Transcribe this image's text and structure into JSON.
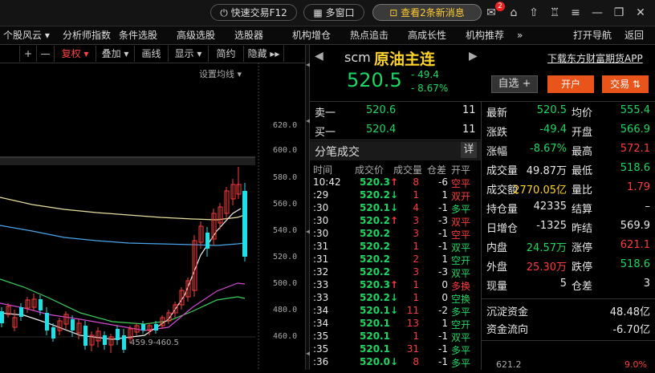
{
  "topbar": {
    "quick_trade": "快速交易F12",
    "multi_window": "多窗口",
    "news": "查看2条新消息",
    "badge": "2"
  },
  "menu": [
    "个股风云 ▾",
    "分析师指数",
    "条件选股",
    "高级选股",
    "选股器",
    "机构增仓",
    "热点追击",
    "高成长性",
    "机构推荐",
    "»",
    "打开导航",
    "返回"
  ],
  "chart_toolbar": [
    "+",
    "—",
    "复权 ▾",
    "叠加 ▾",
    "画线",
    "显示 ▾",
    "简约",
    "隐藏 ▸▸"
  ],
  "chart": {
    "avg_setting": "设置均线 ▾",
    "y_labels": [
      "620.0",
      "600.0",
      "580.0",
      "560.0",
      "540.0",
      "520.0",
      "500.0",
      "480.0",
      "460.0"
    ],
    "low_annotation": "459.9-460.5"
  },
  "quote": {
    "code": "scm",
    "name": "原油主连",
    "price": "520.5",
    "change": "- 49.4",
    "change_pct": "- 8.67%",
    "ad_link": "下载东方财富期货APP",
    "btn_self": "自选 +",
    "btn_open": "开户",
    "btn_trade": "交易 ⇅"
  },
  "orderbook": [
    {
      "label": "卖一",
      "price": "520.6",
      "vol": "11"
    },
    {
      "label": "买一",
      "price": "520.4",
      "vol": "11"
    }
  ],
  "ticks_section": {
    "title": "分笔成交",
    "detail_btn": "详",
    "headers": [
      "时间",
      "成交价",
      "成交量",
      "仓差",
      "开平"
    ]
  },
  "ticks": [
    {
      "t": "10:42",
      "p": "520.3",
      "d": "up",
      "v": "8",
      "c": "-6",
      "k": "空平",
      "kc": "red"
    },
    {
      "t": ":29",
      "p": "520.2",
      "d": "down",
      "v": "1",
      "c": "1",
      "k": "双开",
      "kc": "red"
    },
    {
      "t": ":30",
      "p": "520.1",
      "d": "down",
      "v": "4",
      "c": "-1",
      "k": "多平",
      "kc": "green"
    },
    {
      "t": ":30",
      "p": "520.2",
      "d": "up",
      "v": "3",
      "c": "-3",
      "k": "双平",
      "kc": "red"
    },
    {
      "t": ":30",
      "p": "520.2",
      "d": "",
      "v": "3",
      "c": "-1",
      "k": "空平",
      "kc": "red"
    },
    {
      "t": ":31",
      "p": "520.2",
      "d": "",
      "v": "1",
      "c": "-1",
      "k": "双平",
      "kc": "green"
    },
    {
      "t": ":31",
      "p": "520.2",
      "d": "",
      "v": "2",
      "c": "1",
      "k": "空开",
      "kc": "green"
    },
    {
      "t": ":32",
      "p": "520.2",
      "d": "",
      "v": "3",
      "c": "-3",
      "k": "双平",
      "kc": "green"
    },
    {
      "t": ":33",
      "p": "520.3",
      "d": "up",
      "v": "1",
      "c": "0",
      "k": "多换",
      "kc": "red"
    },
    {
      "t": ":33",
      "p": "520.2",
      "d": "down",
      "v": "1",
      "c": "0",
      "k": "空换",
      "kc": "green"
    },
    {
      "t": ":34",
      "p": "520.1",
      "d": "down",
      "v": "11",
      "c": "-2",
      "k": "多平",
      "kc": "green"
    },
    {
      "t": ":34",
      "p": "520.1",
      "d": "",
      "v": "13",
      "c": "1",
      "k": "空开",
      "kc": "green"
    },
    {
      "t": ":35",
      "p": "520.1",
      "d": "",
      "v": "1",
      "c": "-1",
      "k": "双平",
      "kc": "green"
    },
    {
      "t": ":35",
      "p": "520.1",
      "d": "",
      "v": "31",
      "c": "-1",
      "k": "多平",
      "kc": "green"
    },
    {
      "t": ":36",
      "p": "520.0",
      "d": "down",
      "v": "8",
      "c": "-1",
      "k": "多平",
      "kc": "green"
    }
  ],
  "stats": [
    {
      "l1": "最新",
      "v1": "520.5",
      "c1": "green",
      "l2": "均价",
      "v2": "555.4",
      "c2": "green"
    },
    {
      "l1": "涨跌",
      "v1": "-49.4",
      "c1": "green",
      "l2": "开盘",
      "v2": "566.9",
      "c2": "green"
    },
    {
      "l1": "涨幅",
      "v1": "-8.67%",
      "c1": "green",
      "l2": "最高",
      "v2": "572.1",
      "c2": "red"
    },
    {
      "l1": "成交量",
      "v1": "49.87万",
      "c1": "white",
      "l2": "最低",
      "v2": "518.6",
      "c2": "green"
    },
    {
      "l1": "成交额",
      "v1": "2770.05亿",
      "c1": "yellow",
      "l2": "量比",
      "v2": "1.79",
      "c2": "red"
    },
    {
      "l1": "持仓量",
      "v1": "42335",
      "c1": "white",
      "l2": "结算",
      "v2": "–",
      "c2": "white"
    },
    {
      "l1": "日增仓",
      "v1": "-1325",
      "c1": "white",
      "l2": "昨结",
      "v2": "569.9",
      "c2": "white"
    },
    {
      "l1": "内盘",
      "v1": "24.57万",
      "c1": "green",
      "l2": "涨停",
      "v2": "621.1",
      "c2": "red"
    },
    {
      "l1": "外盘",
      "v1": "25.30万",
      "c1": "red",
      "l2": "跌停",
      "v2": "518.6",
      "c2": "green"
    },
    {
      "l1": "现量",
      "v1": "5",
      "c1": "white",
      "l2": "仓差",
      "v2": "3",
      "c2": "white"
    }
  ],
  "funds": [
    {
      "label": "沉淀资金",
      "value": "48.48亿"
    },
    {
      "label": "资金流向",
      "value": "-6.70亿"
    }
  ],
  "bottom": {
    "left": "621.2",
    "right": "9.0%"
  },
  "colors": {
    "up": "#ff3b3b",
    "down": "#1ed760",
    "accent": "#e8541a",
    "neutral": "#e8e8e8"
  }
}
